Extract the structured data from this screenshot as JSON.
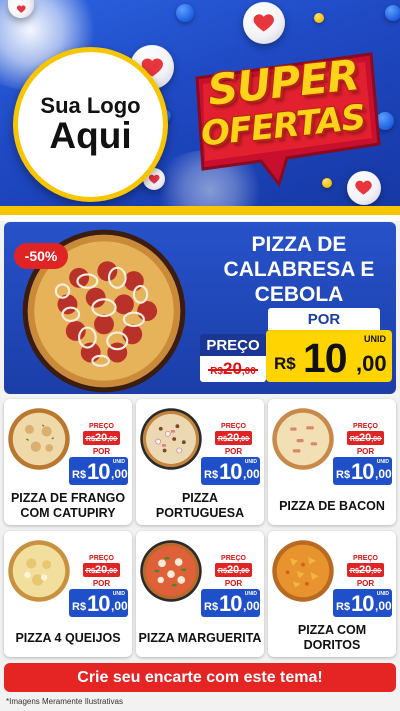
{
  "header": {
    "logo_line1": "Sua Logo",
    "logo_line2": "Aqui",
    "badge_line1": "SUPER",
    "badge_line2": "OFERTAS"
  },
  "featured": {
    "discount": "-50%",
    "name": "PIZZA DE CALABRESA E CEBOLA",
    "preco_label": "PREÇO",
    "old_currency": "R$",
    "old_int": "20",
    "old_dec": ",00",
    "por_label": "POR",
    "unid": "UNID",
    "new_currency": "R$",
    "new_int": "10",
    "new_dec": ",00"
  },
  "products": [
    {
      "name": "PIZZA DE FRANGO COM CATUPIRY",
      "preco_label": "PREÇO",
      "old_currency": "R$",
      "old_int": "20",
      "old_dec": ",00",
      "por_label": "POR",
      "unid": "UNID",
      "new_currency": "R$",
      "new_int": "10",
      "new_dec": ",00"
    },
    {
      "name": "PIZZA PORTUGUESA",
      "preco_label": "PREÇO",
      "old_currency": "R$",
      "old_int": "20",
      "old_dec": ",00",
      "por_label": "POR",
      "unid": "UNID",
      "new_currency": "R$",
      "new_int": "10",
      "new_dec": ",00"
    },
    {
      "name": "PIZZA DE BACON",
      "preco_label": "PREÇO",
      "old_currency": "R$",
      "old_int": "20",
      "old_dec": ",00",
      "por_label": "POR",
      "unid": "UNID",
      "new_currency": "R$",
      "new_int": "10",
      "new_dec": ",00"
    },
    {
      "name": "PIZZA 4 QUEIJOS",
      "preco_label": "PREÇO",
      "old_currency": "R$",
      "old_int": "20",
      "old_dec": ",00",
      "por_label": "POR",
      "unid": "UNID",
      "new_currency": "R$",
      "new_int": "10",
      "new_dec": ",00"
    },
    {
      "name": "PIZZA MARGUERITA",
      "preco_label": "PREÇO",
      "old_currency": "R$",
      "old_int": "20",
      "old_dec": ",00",
      "por_label": "POR",
      "unid": "UNID",
      "new_currency": "R$",
      "new_int": "10",
      "new_dec": ",00"
    },
    {
      "name": "PIZZA COM DORITOS",
      "preco_label": "PREÇO",
      "old_currency": "R$",
      "old_int": "20",
      "old_dec": ",00",
      "por_label": "POR",
      "unid": "UNID",
      "new_currency": "R$",
      "new_int": "10",
      "new_dec": ",00"
    }
  ],
  "footer": {
    "cta": "Crie seu encarte com este tema!",
    "disclaimer": "*Imagens Meramente Ilustrativas"
  },
  "colors": {
    "header_blue": "#1f48c2",
    "accent_yellow": "#f7c600",
    "price_red": "#e02424",
    "price_blue": "#1f4fc9"
  }
}
